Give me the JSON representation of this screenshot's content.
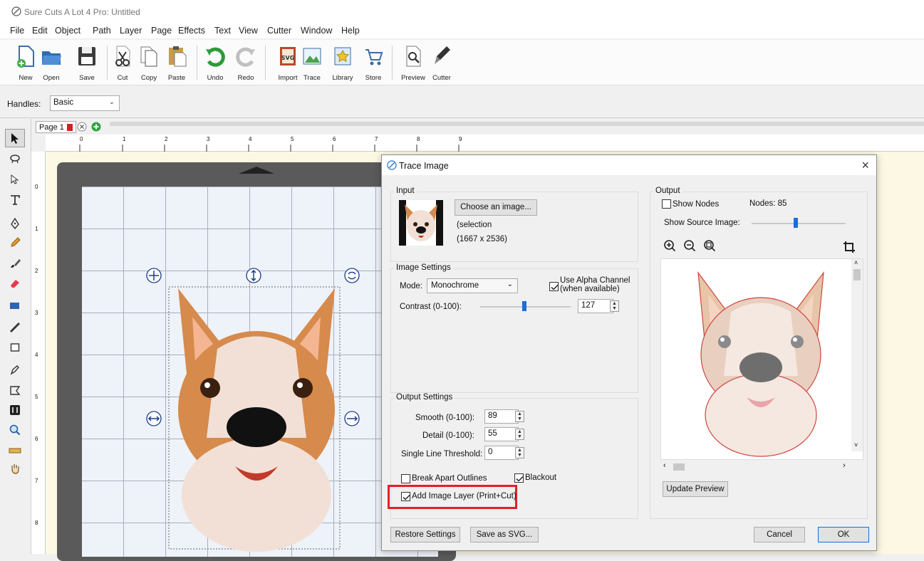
{
  "app": {
    "title": "Sure Cuts A Lot 4 Pro: Untitled"
  },
  "menu": [
    "File",
    "Edit",
    "Object",
    "Path",
    "Layer",
    "Page",
    "Effects",
    "Text",
    "View",
    "Cutter",
    "Window",
    "Help"
  ],
  "toolbar": {
    "buttons": [
      {
        "label": "New",
        "icon": "new-document-icon"
      },
      {
        "label": "Open",
        "icon": "open-folder-icon"
      },
      {
        "label": "Save",
        "icon": "floppy-disk-icon"
      },
      {
        "label": "Cut",
        "icon": "scissors-icon"
      },
      {
        "label": "Copy",
        "icon": "copy-icon"
      },
      {
        "label": "Paste",
        "icon": "paste-icon"
      },
      {
        "label": "Undo",
        "icon": "undo-arrow-icon"
      },
      {
        "label": "Redo",
        "icon": "redo-arrow-icon"
      },
      {
        "label": "Import",
        "icon": "svg-import-icon"
      },
      {
        "label": "Trace",
        "icon": "trace-icon"
      },
      {
        "label": "Library",
        "icon": "library-star-icon"
      },
      {
        "label": "Store",
        "icon": "store-cart-icon"
      },
      {
        "label": "Preview",
        "icon": "magnifier-preview-icon"
      },
      {
        "label": "Cutter",
        "icon": "blade-cutter-icon"
      }
    ]
  },
  "handles": {
    "label": "Handles:",
    "value": "Basic"
  },
  "tabs": {
    "page_label": "Page 1"
  },
  "ruler": {
    "h_ticks": [
      "0",
      "1",
      "2",
      "3",
      "4",
      "5",
      "6",
      "7",
      "8",
      "9"
    ],
    "v_ticks": [
      "0",
      "1",
      "2",
      "3",
      "4",
      "5",
      "6",
      "7",
      "8"
    ]
  },
  "dialog": {
    "title": "Trace Image",
    "input": {
      "group_label": "Input",
      "choose_button": "Choose an image...",
      "source_line1": "(selection",
      "source_line2": "(1667 x 2536)"
    },
    "image_settings": {
      "group_label": "Image Settings",
      "mode_label": "Mode:",
      "mode_value": "Monochrome",
      "alpha_line1": "Use Alpha Channel",
      "alpha_line2": "(when available)",
      "alpha_checked": true,
      "contrast_label": "Contrast (0-100):",
      "contrast_value": "127"
    },
    "output_settings": {
      "group_label": "Output Settings",
      "smooth_label": "Smooth (0-100):",
      "smooth_value": "89",
      "detail_label": "Detail (0-100):",
      "detail_value": "55",
      "threshold_label": "Single Line Threshold:",
      "threshold_value": "0",
      "break_apart_label": "Break Apart Outlines",
      "break_apart_checked": false,
      "blackout_label": "Blackout",
      "blackout_checked": true,
      "add_layer_label": "Add Image Layer (Print+Cut)",
      "add_layer_checked": true
    },
    "output": {
      "group_label": "Output",
      "show_nodes_label": "Show Nodes",
      "show_nodes_checked": false,
      "nodes_text": "Nodes: 85",
      "show_source_label": "Show Source Image:",
      "update_button": "Update Preview"
    },
    "footer": {
      "restore_button": "Restore Settings",
      "save_svg_button": "Save as SVG...",
      "cancel_button": "Cancel",
      "ok_button": "OK"
    }
  },
  "colors": {
    "accent": "#1a6ed8",
    "highlight": "#e2202a",
    "mat": "#5a5a5a",
    "workspace": "#fdf8e4"
  }
}
